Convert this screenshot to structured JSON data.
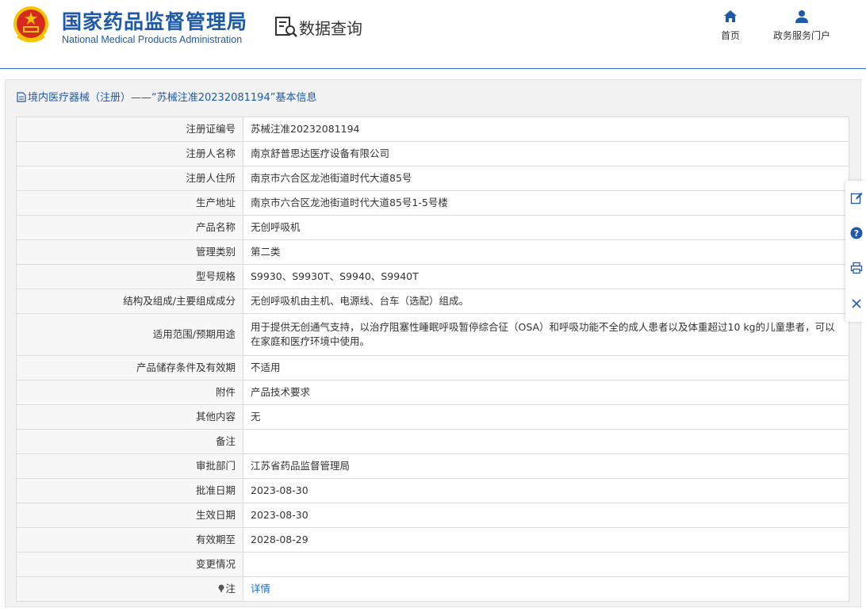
{
  "header": {
    "agency_cn": "国家药品监督管理局",
    "agency_en": "National Medical Products Administration",
    "section_title": "数据查询",
    "nav": [
      {
        "label": "首页",
        "icon": "home-icon"
      },
      {
        "label": "政务服务门户",
        "icon": "user-icon"
      }
    ]
  },
  "panel": {
    "title": "境内医疗器械（注册）——“苏械注准20232081194”基本信息"
  },
  "rows": [
    {
      "label": "注册证编号",
      "value": "苏械注准20232081194"
    },
    {
      "label": "注册人名称",
      "value": "南京舒普思达医疗设备有限公司"
    },
    {
      "label": "注册人住所",
      "value": "南京市六合区龙池街道时代大道85号"
    },
    {
      "label": "生产地址",
      "value": "南京市六合区龙池街道时代大道85号1-5号楼"
    },
    {
      "label": "产品名称",
      "value": "无创呼吸机"
    },
    {
      "label": "管理类别",
      "value": "第二类"
    },
    {
      "label": "型号规格",
      "value": "S9930、S9930T、S9940、S9940T"
    },
    {
      "label": "结构及组成/主要组成成分",
      "value": "无创呼吸机由主机、电源线、台车（选配）组成。"
    },
    {
      "label": "适用范围/预期用途",
      "value": "用于提供无创通气支持，以治疗阻塞性睡眠呼吸暂停综合征（OSA）和呼吸功能不全的成人患者以及体重超过10 kg的儿童患者，可以在家庭和医疗环境中使用。"
    },
    {
      "label": "产品储存条件及有效期",
      "value": "不适用"
    },
    {
      "label": "附件",
      "value": "产品技术要求"
    },
    {
      "label": "其他内容",
      "value": "无"
    },
    {
      "label": "备注",
      "value": ""
    },
    {
      "label": "审批部门",
      "value": "江苏省药品监督管理局"
    },
    {
      "label": "批准日期",
      "value": "2023-08-30"
    },
    {
      "label": "生效日期",
      "value": "2023-08-30"
    },
    {
      "label": "有效期至",
      "value": "2028-08-29"
    },
    {
      "label": "变更情况",
      "value": ""
    },
    {
      "label": "注",
      "value": "详情"
    }
  ],
  "sidebar_tools": [
    "edit-icon",
    "help-icon",
    "print-icon",
    "close-icon"
  ],
  "colors": {
    "brand_blue": "#1e5aa8",
    "link_blue": "#1e6fc4",
    "emblem_red": "#d52b1e",
    "emblem_gold": "#f5c400"
  }
}
